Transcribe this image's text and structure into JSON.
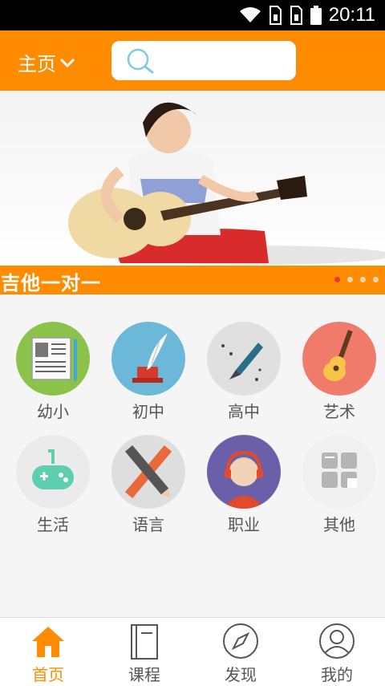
{
  "status_bar": {
    "time": "20:11"
  },
  "header": {
    "home_label": "主页",
    "search_placeholder": ""
  },
  "banner": {
    "caption": "吉他一对一",
    "slide_count": 4,
    "active_slide": 1
  },
  "categories": [
    {
      "label": "幼小",
      "icon": "book-icon",
      "color": "#8bc34a"
    },
    {
      "label": "初中",
      "icon": "quill-icon",
      "color": "#6cb8d8"
    },
    {
      "label": "高中",
      "icon": "fountain-pen-icon",
      "color": "#e0e0e0"
    },
    {
      "label": "艺术",
      "icon": "guitar-icon",
      "color": "#f07b6b"
    },
    {
      "label": "生活",
      "icon": "gamepad-icon",
      "color": "#ebebeb"
    },
    {
      "label": "语言",
      "icon": "pencil-ruler-icon",
      "color": "#dedede"
    },
    {
      "label": "职业",
      "icon": "headphones-person-icon",
      "color": "#6a5fa8"
    },
    {
      "label": "其他",
      "icon": "grid-apps-icon",
      "color": "#f0f0f0"
    }
  ],
  "tabbar": {
    "items": [
      {
        "label": "首页",
        "icon": "home-icon"
      },
      {
        "label": "课程",
        "icon": "notebook-icon"
      },
      {
        "label": "发现",
        "icon": "compass-icon"
      },
      {
        "label": "我的",
        "icon": "user-icon"
      }
    ],
    "active_color": "#ff8c00"
  },
  "colors": {
    "accent": "#ff8c00",
    "inactive": "#555555"
  }
}
